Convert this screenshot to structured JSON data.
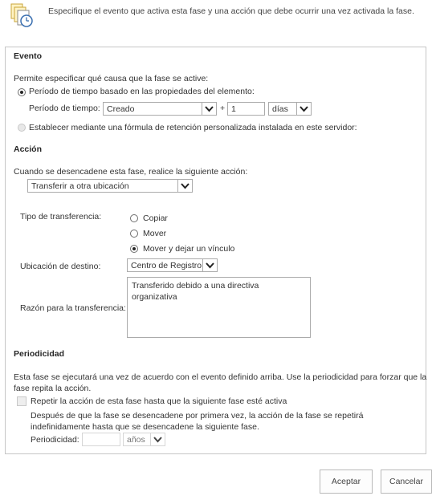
{
  "header": {
    "icon": "document-clock-icon",
    "description": "Especifique el evento que activa esta fase y una acción que debe ocurrir una vez activada la fase."
  },
  "evento": {
    "title": "Evento",
    "intro": "Permite especificar qué causa que la fase se active:",
    "option_period": "Período de tiempo basado en las propiedades del elemento:",
    "period_label": "Período de tiempo:",
    "period_property": "Creado",
    "plus": "+",
    "period_amount": "1",
    "period_unit": "días",
    "option_formula": "Establecer mediante una fórmula de retención personalizada instalada en este servidor:"
  },
  "accion": {
    "title": "Acción",
    "intro": "Cuando se desencadene esta fase, realice la siguiente acción:",
    "action_value": "Transferir a otra ubicación",
    "transfer_type_label": "Tipo de transferencia:",
    "transfer_options": [
      "Copiar",
      "Mover",
      "Mover y dejar un vínculo"
    ],
    "destination_label": "Ubicación de destino:",
    "destination_value": "Centro de Registro",
    "reason_label": "Razón para la transferencia:",
    "reason_value": "Transferido debido a una directiva organizativa"
  },
  "periodicidad": {
    "title": "Periodicidad",
    "description_line1": "Esta fase se ejecutará una vez de acuerdo con el evento definido arriba. Use la periodicidad para forzar que la",
    "description_line2": "fase repita la acción.",
    "repeat_label": "Repetir la acción de esta fase hasta que la siguiente fase esté activa",
    "note_line1": "Después de que la fase se desencadene por primera vez, la acción de la fase se repetirá",
    "note_line2": "indefinidamente hasta que se desencadene la siguiente fase.",
    "period_label": "Periodicidad:",
    "period_value": "",
    "period_unit": "años"
  },
  "buttons": {
    "accept": "Aceptar",
    "cancel": "Cancelar"
  }
}
